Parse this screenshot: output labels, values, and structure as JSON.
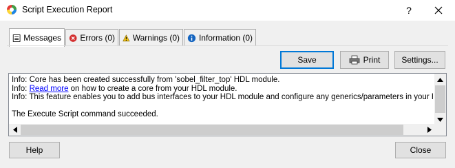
{
  "window": {
    "title": "Script Execution Report",
    "help_label": "?",
    "close_label": "Close window"
  },
  "tabs": [
    {
      "label": "Messages",
      "icon": "messages-icon",
      "active": true
    },
    {
      "label": "Errors (0)",
      "icon": "error-icon"
    },
    {
      "label": "Warnings (0)",
      "icon": "warning-icon"
    },
    {
      "label": "Information (0)",
      "icon": "information-icon"
    }
  ],
  "toolbar": {
    "save_label": "Save",
    "print_label": "Print",
    "settings_label": "Settings..."
  },
  "log": {
    "line1": "Info: Core has been created successfully from 'sobel_filter_top' HDL module.",
    "line2_prefix": "Info: ",
    "line2_link": "Read more",
    "line2_suffix": " on how to create a core from your HDL module.",
    "line3": "Info: This feature enables you to add bus interfaces to your HDL module and configure any generics/parameters in your HDL mo",
    "line5": "The Execute Script command succeeded."
  },
  "footer": {
    "help_label": "Help",
    "close_label": "Close"
  },
  "colors": {
    "accent": "#0078d7",
    "link": "#0000ff",
    "error": "#d32f2f",
    "warning": "#f5c518",
    "information": "#1565c0"
  }
}
